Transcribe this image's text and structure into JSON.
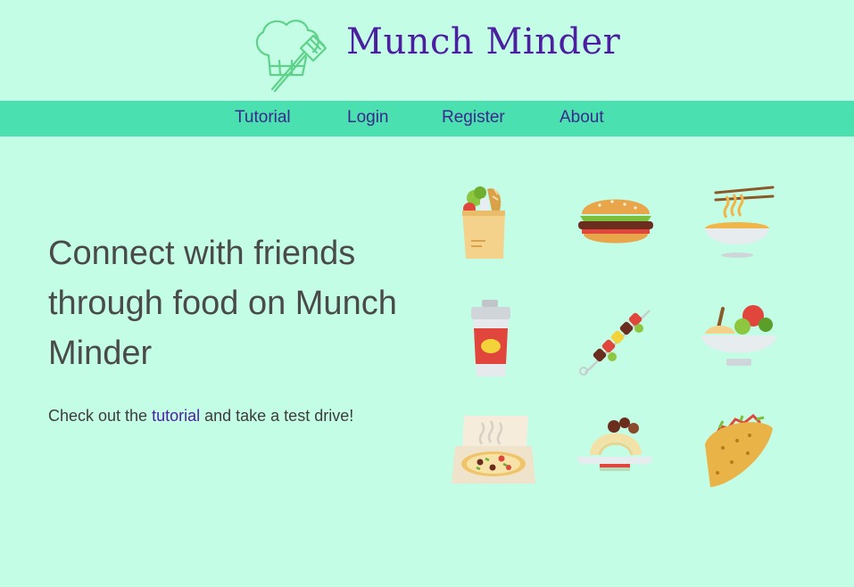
{
  "brand": {
    "name": "Munch Minder",
    "logo_icon": "chef-hat-spatula-icon",
    "color": "#4b1fa0"
  },
  "nav": {
    "items": [
      {
        "label": "Tutorial"
      },
      {
        "label": "Login"
      },
      {
        "label": "Register"
      },
      {
        "label": "About"
      }
    ],
    "background": "#4ae0b0"
  },
  "hero": {
    "headline": "Connect with friends through food on Munch Minder",
    "subtext_before": "Check out the ",
    "subtext_link": "tutorial",
    "subtext_after": " and take a test drive!"
  },
  "food_icons": [
    "grocery-bag-icon",
    "burger-icon",
    "noodle-bowl-icon",
    "coffee-cup-icon",
    "kebab-skewer-icon",
    "salad-bowl-icon",
    "pizza-box-icon",
    "spaghetti-meatballs-icon",
    "taco-icon"
  ],
  "colors": {
    "background": "#c4fde6",
    "text": "#4a4a4a",
    "link": "#4b1fa0"
  }
}
